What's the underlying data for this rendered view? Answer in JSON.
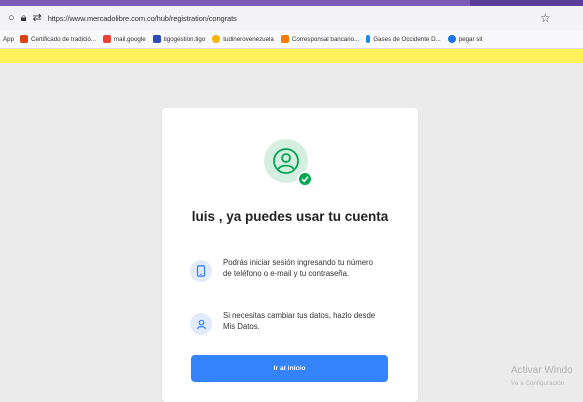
{
  "browser": {
    "url": "https://www.mercadolibre.com.co/hub/registration/congrats",
    "icons": [
      "circle-icon",
      "lock-icon",
      "tune-icon",
      "star-icon"
    ]
  },
  "bookmarks": [
    {
      "label": "App",
      "color": "#4285f4"
    },
    {
      "label": "Certificado de tradició...",
      "color": "#d84315"
    },
    {
      "label": "mail.google",
      "color": "#ea4335"
    },
    {
      "label": "tigogestion.tigo",
      "color": "#2b4bbb"
    },
    {
      "label": "tudinerovenezuela",
      "color": "#f4b400"
    },
    {
      "label": "Corresponsal bancario...",
      "color": "#f57c00"
    },
    {
      "label": "Gases de Occidente D...",
      "color": "#1e88e5"
    },
    {
      "label": "pegar sit",
      "color": "#1a73e8"
    }
  ],
  "card": {
    "title": "luis , ya puedes usar tu cuenta",
    "info1": "Podrás iniciar sesión ingresando tu número de teléfono o e-mail y tu contraseña.",
    "info2": "Si necesitas cambiar tus datos, hazlo desde Mis Datos.",
    "button": "Ir al inicio"
  },
  "watermark": {
    "line1": "Activar Windo",
    "line2": "Ve a Configuración"
  },
  "colors": {
    "accent": "#3483fa",
    "brand_yellow": "#fff159",
    "success": "#00a650"
  }
}
